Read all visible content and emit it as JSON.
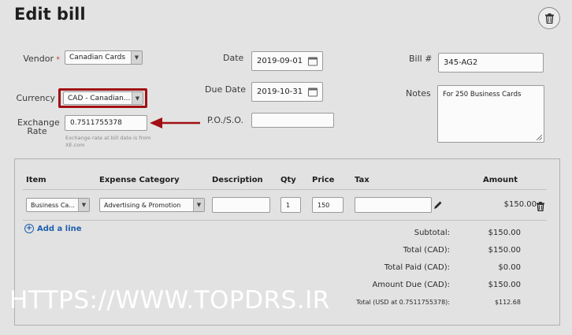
{
  "page": {
    "title": "Edit bill"
  },
  "form": {
    "vendor": {
      "label": "Vendor",
      "required_mark": "*",
      "value": "Canadian Cards"
    },
    "currency": {
      "label": "Currency",
      "value": "CAD - Canadian..."
    },
    "exchange_rate": {
      "label_line1": "Exchange",
      "label_line2": "Rate",
      "value": "0.7511755378",
      "hint_line1": "Exchange rate at bill date is from",
      "hint_line2": "XE.com"
    },
    "date": {
      "label": "Date",
      "value": "2019-09-01"
    },
    "due_date": {
      "label": "Due Date",
      "value": "2019-10-31"
    },
    "po_so": {
      "label": "P.O./S.O.",
      "value": ""
    },
    "bill_number": {
      "label": "Bill #",
      "value": "345-AG2"
    },
    "notes": {
      "label": "Notes",
      "value": "For 250 Business Cards"
    }
  },
  "table": {
    "headers": {
      "item": "Item",
      "expense_category": "Expense Category",
      "description": "Description",
      "qty": "Qty",
      "price": "Price",
      "tax": "Tax",
      "amount": "Amount"
    },
    "rows": [
      {
        "item": "Business Ca...",
        "expense_category": "Advertising & Promotion",
        "description": "",
        "qty": "1",
        "price": "150",
        "tax": "",
        "amount": "$150.00"
      }
    ],
    "add_line_label": "Add a line"
  },
  "totals": [
    {
      "label": "Subtotal:",
      "value": "$150.00"
    },
    {
      "label": "Total (CAD):",
      "value": "$150.00"
    },
    {
      "label": "Total Paid (CAD):",
      "value": "$0.00"
    },
    {
      "label": "Amount Due (CAD):",
      "value": "$150.00"
    },
    {
      "label": "Total (USD at 0.7511755378):",
      "value": "$112.68"
    }
  ],
  "watermark": "HTTPS://WWW.TOPDRS.IR",
  "colors": {
    "highlight": "#a10f14",
    "link": "#1f5fae",
    "background": "#e3e3e3"
  },
  "icons": {
    "delete": "trash-icon",
    "calendar": "calendar-icon",
    "edit": "pencil-icon",
    "add": "plus-circle-icon",
    "dropdown": "caret-down-icon"
  }
}
